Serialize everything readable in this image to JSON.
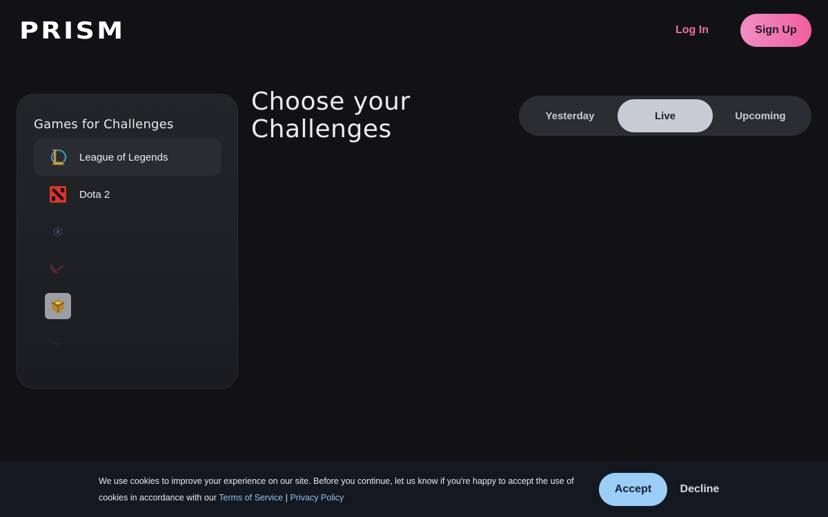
{
  "header": {
    "logo": "PRISM",
    "login_label": "Log In",
    "signup_label": "Sign Up"
  },
  "sidebar": {
    "title": "Games for Challenges",
    "items": [
      {
        "label": "League of Legends",
        "icon": "league-of-legends-icon",
        "active": true
      },
      {
        "label": "Dota 2",
        "icon": "dota2-icon",
        "active": false
      },
      {
        "label": "",
        "icon": "game-icon-3"
      },
      {
        "label": "",
        "icon": "valorant-icon"
      },
      {
        "label": "",
        "icon": "game-icon-5"
      },
      {
        "label": "",
        "icon": "game-icon-6"
      }
    ]
  },
  "main": {
    "heading_line1": "Choose your",
    "heading_line2": "Challenges",
    "tabs": [
      {
        "label": "Yesterday",
        "active": false
      },
      {
        "label": "Live",
        "active": true
      },
      {
        "label": "Upcoming",
        "active": false
      }
    ]
  },
  "cookie": {
    "text_part1": "We use cookies to improve your experience on our site. Before you continue, let us know if you're happy to accept the use of cookies in accordance with our ",
    "terms_link": "Terms of Service",
    "separator": " | ",
    "privacy_link": "Privacy Policy",
    "accept_label": "Accept",
    "decline_label": "Decline"
  },
  "colors": {
    "background": "#121214",
    "accent_pink": "#ee6fa6",
    "accept_blue": "#9ccdf6"
  }
}
